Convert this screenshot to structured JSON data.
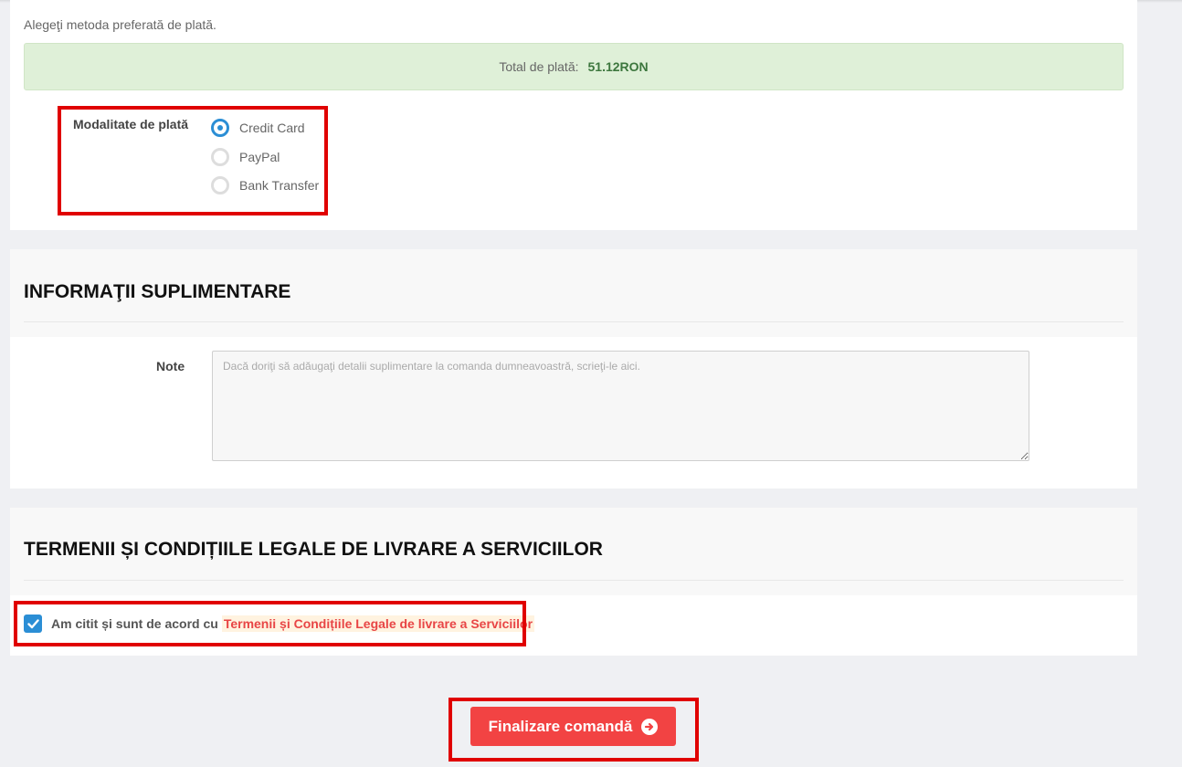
{
  "payment": {
    "intro": "Alegeţi metoda preferată de plată.",
    "total_label": "Total de plată:",
    "total_value": "51.12RON",
    "method_label": "Modalitate de plată",
    "methods": [
      {
        "label": "Credit Card",
        "selected": true
      },
      {
        "label": "PayPal",
        "selected": false
      },
      {
        "label": "Bank Transfer",
        "selected": false
      }
    ]
  },
  "additional_info": {
    "title": "INFORMAŢII SUPLIMENTARE",
    "note_label": "Note",
    "note_placeholder": "Dacă doriţi să adăugaţi detalii suplimentare la comanda dumneavoastră, scrieţi-le aici.",
    "note_value": ""
  },
  "terms": {
    "title": "TERMENII ȘI CONDIȚIILE LEGALE DE LIVRARE A SERVICIILOR",
    "agree_text": "Am citit și sunt de acord cu",
    "link_text": "Termenii și Condițiile Legale de livrare a Serviciilor",
    "checked": true
  },
  "finish": {
    "label": "Finalizare comandă",
    "icon": "arrow-circle-right-icon"
  },
  "colors": {
    "accent": "#2b8ed5",
    "button": "#f24343",
    "highlight": "#e00000",
    "total_bg": "#dff0d8",
    "total_text": "#3c763d"
  }
}
